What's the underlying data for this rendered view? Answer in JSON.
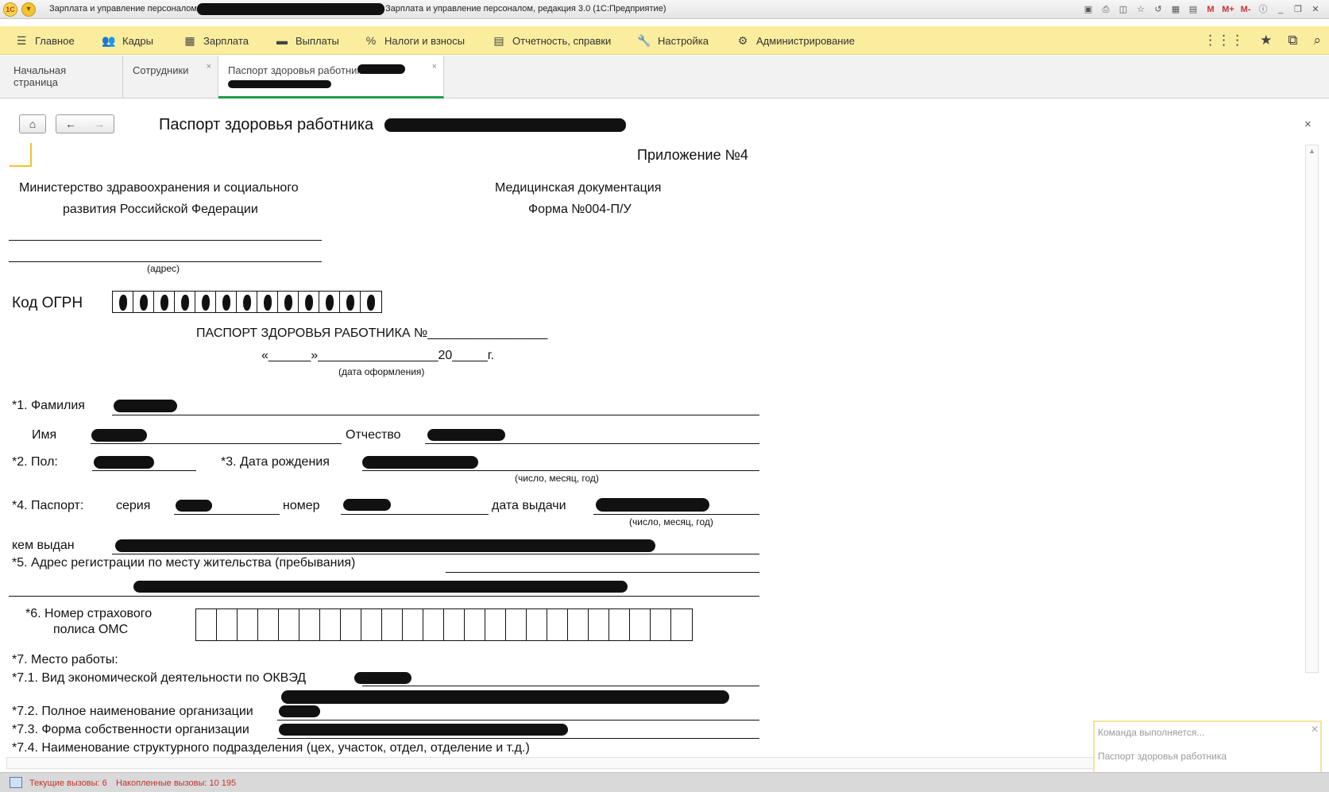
{
  "titlebar": {
    "title_prefix": "Зарплата и управление персоналом",
    "title_suffix": "Зарплата и управление персоналом, редакция 3.0  (1С:Предприятие)",
    "logo": "1С",
    "buttons": [
      "M",
      "M+",
      "M-"
    ]
  },
  "sections": [
    {
      "label": "Главное",
      "icon": "hamburger-icon"
    },
    {
      "label": "Кадры",
      "icon": "people-icon"
    },
    {
      "label": "Зарплата",
      "icon": "calculator-icon"
    },
    {
      "label": "Выплаты",
      "icon": "wallet-icon"
    },
    {
      "label": "Налоги и взносы",
      "icon": "percent-icon"
    },
    {
      "label": "Отчетность, справки",
      "icon": "report-icon"
    },
    {
      "label": "Настройка",
      "icon": "wrench-icon"
    },
    {
      "label": "Администрирование",
      "icon": "gear-icon"
    }
  ],
  "tabs": [
    {
      "label": "Начальная страница"
    },
    {
      "label": "Сотрудники",
      "close": "×"
    },
    {
      "label": "Паспорт здоровья работника",
      "close": "×"
    }
  ],
  "header": {
    "title": "Паспорт здоровья работника",
    "close": "×"
  },
  "document": {
    "appendix": "Приложение №4",
    "ministry_line1": "Министерство здравоохранения и социального",
    "ministry_line2": "развития Российской Федерации",
    "med_doc": "Медицинская документация",
    "form": "Форма №004-П/У",
    "address_caption": "(адрес)",
    "ogrn_label": "Код ОГРН",
    "passport_heading": "ПАСПОРТ ЗДОРОВЬЯ РАБОТНИКА №_________________",
    "date_line": "«______»_________________20_____г.",
    "date_caption": "(дата оформления)",
    "f1_label": "*1. Фамилия",
    "name_label": "Имя",
    "patronymic_label": "Отчество",
    "f2_label": "*2. Пол:",
    "f3_label": "*3. Дата рождения",
    "dmy_caption": "(число, месяц, год)",
    "f4_label": "*4. Паспорт:",
    "series_label": "серия",
    "number_label": "номер",
    "issue_date_label": "дата выдачи",
    "issued_by_label": "кем выдан",
    "f5_label": "*5. Адрес регистрации по месту жительства (пребывания)",
    "f6_label_line1": "*6. Номер страхового",
    "f6_label_line2": "полиса ОМС",
    "f7_label": "*7. Место работы:",
    "f71_label": "*7.1. Вид экономической деятельности по ОКВЭД",
    "f72_label": "*7.2. Полное наименование организации",
    "f73_label": "*7.3. Форма собственности организации",
    "f74_label": "*7.4. Наименование структурного подразделения (цех, участок, отдел, отделение и т.д.)"
  },
  "notification": {
    "line1": "Команда выполняется...",
    "line2": "Паспорт здоровья работника"
  },
  "status": {
    "current_calls": "Текущие вызовы: 6",
    "accumulated_calls": "Накопленные вызовы: 10 195"
  },
  "colors": {
    "sections_bg": "#fbed9e",
    "active_tab_underline": "#1f9e4a",
    "status_text": "#c0332c"
  }
}
